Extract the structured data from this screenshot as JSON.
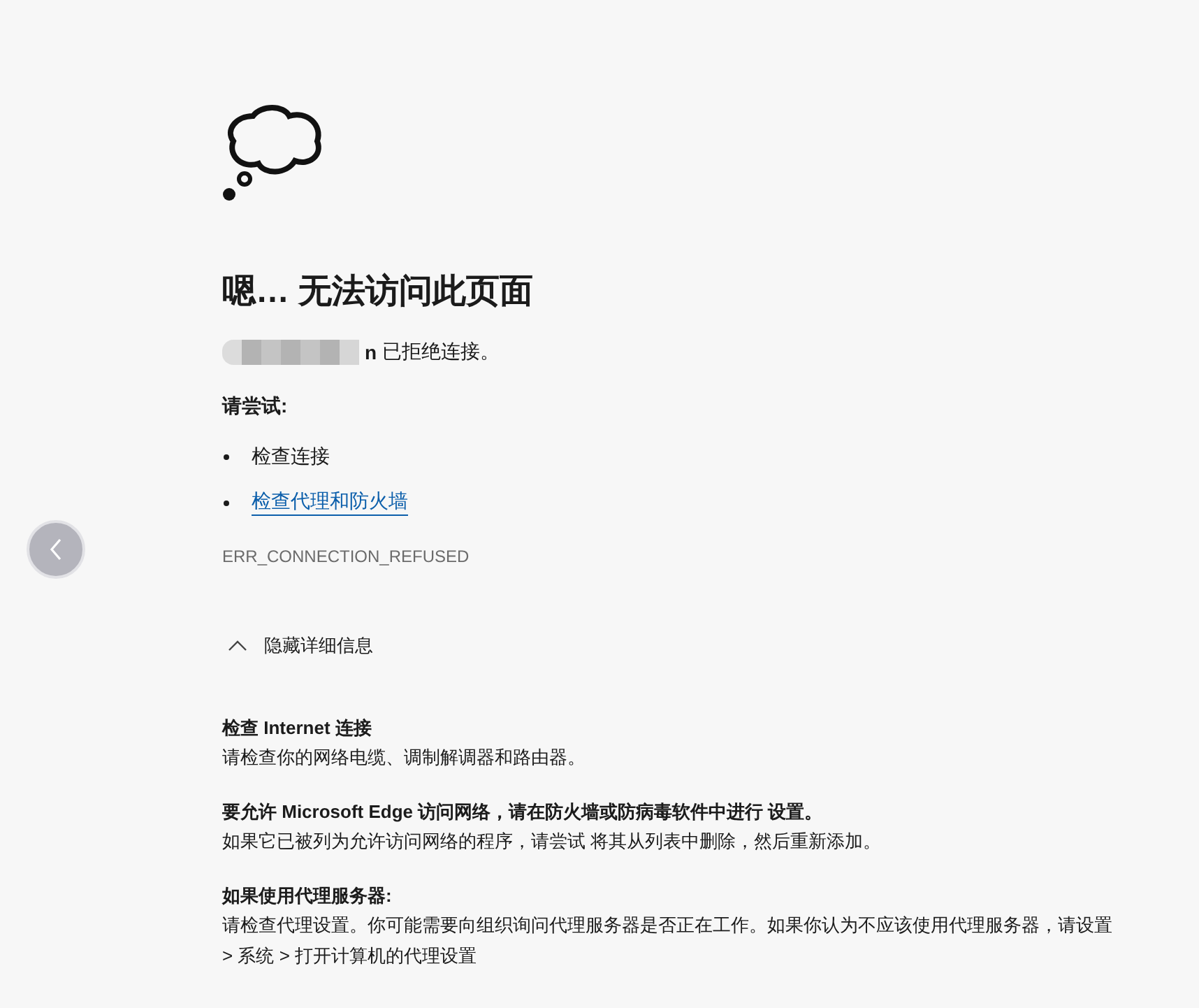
{
  "title": "嗯… 无法访问此页面",
  "connection": {
    "host_visible": "n",
    "message": "已拒绝连接。"
  },
  "suggestions_heading": "请尝试:",
  "suggestions": [
    {
      "kind": "text",
      "text": "检查连接"
    },
    {
      "kind": "link",
      "text": "检查代理和防火墙"
    }
  ],
  "error_code": "ERR_CONNECTION_REFUSED",
  "details_toggle": {
    "label": "隐藏详细信息",
    "expanded": true
  },
  "details": [
    {
      "heading": "检查 Internet 连接",
      "body": "请检查你的网络电缆、调制解调器和路由器。"
    },
    {
      "heading": "要允许 Microsoft Edge 访问网络，请在防火墙或防病毒软件中进行 设置。",
      "body": "如果它已被列为允许访问网络的程序，请尝试 将其从列表中删除，然后重新添加。"
    },
    {
      "heading": "如果使用代理服务器:",
      "body": "请检查代理设置。你可能需要向组织询问代理服务器是否正在工作。如果你认为不应该使用代理服务器，请设置 > 系统 > 打开计算机的代理设置"
    }
  ]
}
